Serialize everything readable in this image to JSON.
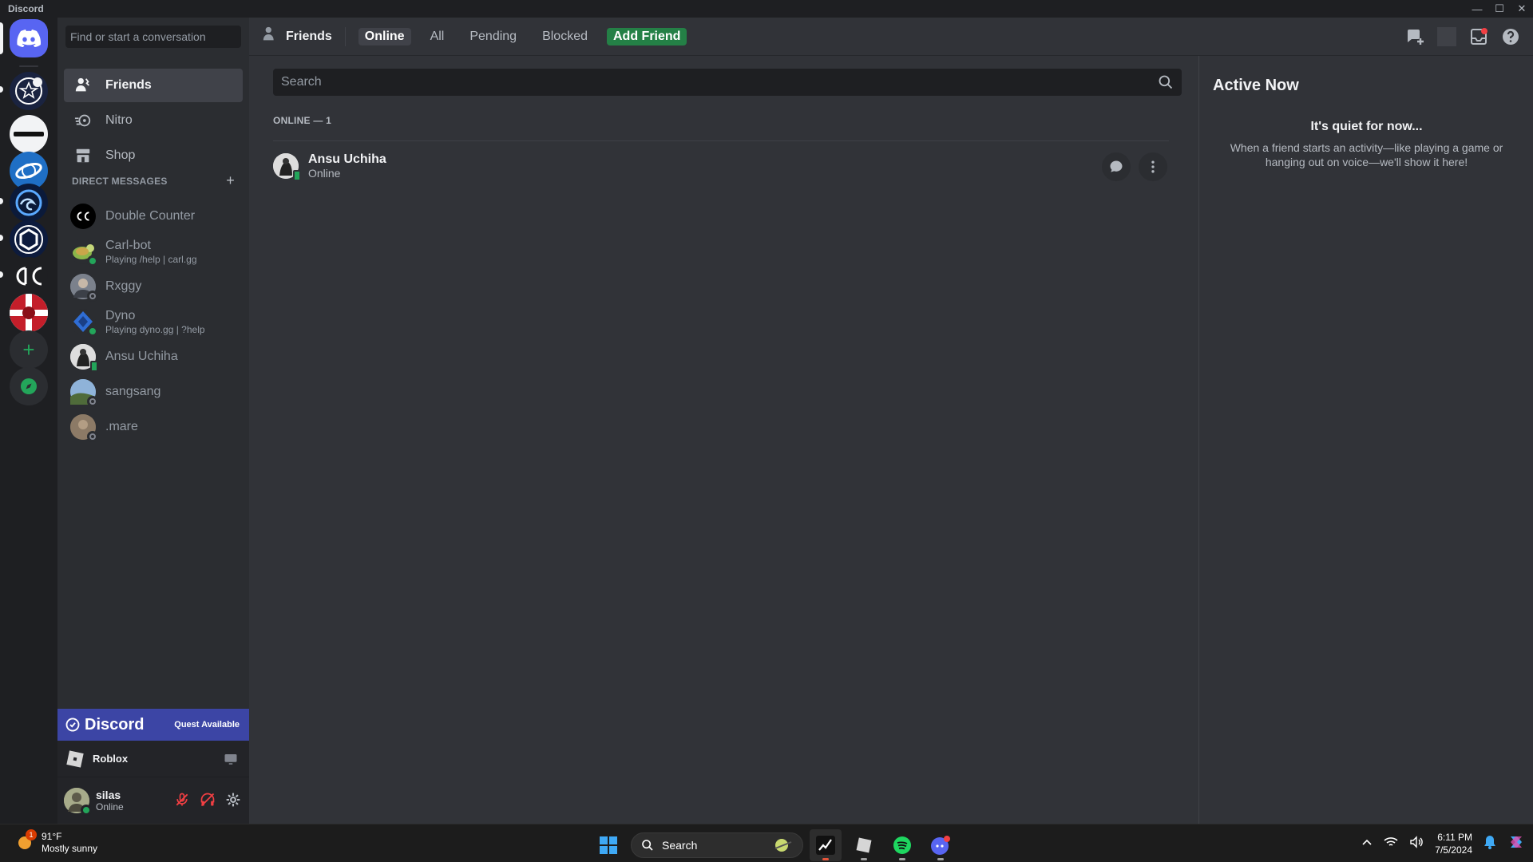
{
  "window": {
    "title": "Discord",
    "controls": [
      "—",
      "☐",
      "✕"
    ]
  },
  "sidebar": {
    "search_placeholder": "Find or start a conversation",
    "nav": [
      {
        "label": "Friends"
      },
      {
        "label": "Nitro"
      },
      {
        "label": "Shop"
      }
    ],
    "dm_header": "DIRECT MESSAGES",
    "dm_add": "+",
    "dms": [
      {
        "name": "Double Counter",
        "sub": "",
        "status": "none"
      },
      {
        "name": "Carl-bot",
        "sub": "Playing /help | carl.gg",
        "status": "online"
      },
      {
        "name": "Rxggy",
        "sub": "",
        "status": "offline"
      },
      {
        "name": "Dyno",
        "sub": "Playing dyno.gg | ?help",
        "status": "online"
      },
      {
        "name": "Ansu Uchiha",
        "sub": "",
        "status": "mobile"
      },
      {
        "name": "sangsang",
        "sub": "",
        "status": "offline"
      },
      {
        "name": ".mare",
        "sub": "",
        "status": "offline"
      }
    ],
    "quest": {
      "brand": "Discord",
      "label": "Quest Available"
    },
    "game": {
      "name": "Roblox"
    },
    "user": {
      "name": "silas",
      "status": "Online"
    }
  },
  "header": {
    "title": "Friends",
    "tabs": [
      "Online",
      "All",
      "Pending",
      "Blocked"
    ],
    "add_friend": "Add Friend"
  },
  "friends": {
    "search_placeholder": "Search",
    "section": "ONLINE — 1",
    "list": [
      {
        "name": "Ansu Uchiha",
        "status": "Online"
      }
    ]
  },
  "active_now": {
    "title": "Active Now",
    "empty_title": "It's quiet for now...",
    "empty_desc": "When a friend starts an activity—like playing a game or hanging out on voice—we'll show it here!"
  },
  "taskbar": {
    "weather": {
      "temp": "91°F",
      "desc": "Mostly sunny",
      "badge": "1"
    },
    "search": "Search",
    "time": "6:11 PM",
    "date": "7/5/2024"
  },
  "colors": {
    "blurple": "#5865f2",
    "green": "#23a55a",
    "add_friend": "#248046",
    "quest": "#3c45a5"
  }
}
